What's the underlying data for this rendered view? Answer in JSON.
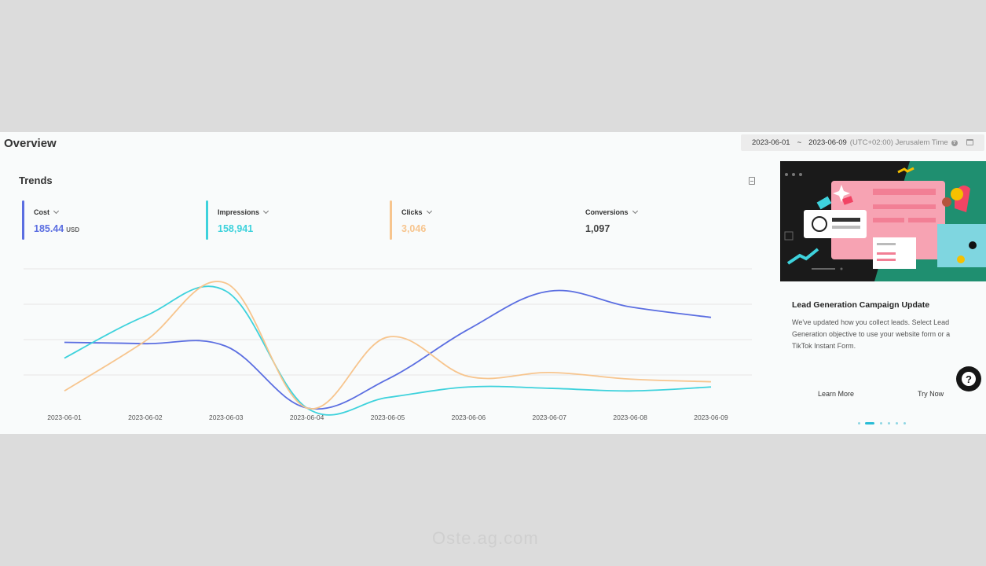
{
  "overview": {
    "title": "Overview",
    "date_start": "2023-06-01",
    "date_sep": "~",
    "date_end": "2023-06-09",
    "timezone": "(UTC+02:00) Jerusalem Time"
  },
  "trends": {
    "title": "Trends",
    "metrics": [
      {
        "label": "Cost",
        "value": "185.44",
        "unit": "USD",
        "color": "#5b6ee1"
      },
      {
        "label": "Impressions",
        "value": "158,941",
        "unit": "",
        "color": "#3ed2dc"
      },
      {
        "label": "Clicks",
        "value": "3,046",
        "unit": "",
        "color": "#f7c58e"
      },
      {
        "label": "Conversions",
        "value": "1,097",
        "unit": "",
        "color": "#ffffff"
      }
    ]
  },
  "chart_data": {
    "type": "line",
    "x": [
      "2023-06-01",
      "2023-06-02",
      "2023-06-03",
      "2023-06-04",
      "2023-06-05",
      "2023-06-06",
      "2023-06-07",
      "2023-06-08",
      "2023-06-09"
    ],
    "series": [
      {
        "name": "Cost",
        "color": "#5b6ee1",
        "values": [
          0.5,
          0.49,
          0.47,
          0.0,
          0.22,
          0.6,
          0.89,
          0.77,
          0.69
        ]
      },
      {
        "name": "Impressions",
        "color": "#3ed2dc",
        "values": [
          0.38,
          0.7,
          0.89,
          0.0,
          0.08,
          0.16,
          0.15,
          0.13,
          0.16
        ]
      },
      {
        "name": "Clicks",
        "color": "#f7c58e",
        "values": [
          0.13,
          0.51,
          0.95,
          0.0,
          0.54,
          0.24,
          0.27,
          0.22,
          0.2
        ]
      }
    ],
    "ylim": [
      0,
      1
    ],
    "grid": true
  },
  "promo": {
    "title": "Lead Generation Campaign Update",
    "description": "We've updated how you collect leads. Select Lead Generation objective to use your website form or a TikTok Instant Form.",
    "learn_more": "Learn More",
    "try_now": "Try Now"
  },
  "help_button": {
    "label": "?"
  },
  "watermark": "Oste.ag.com"
}
